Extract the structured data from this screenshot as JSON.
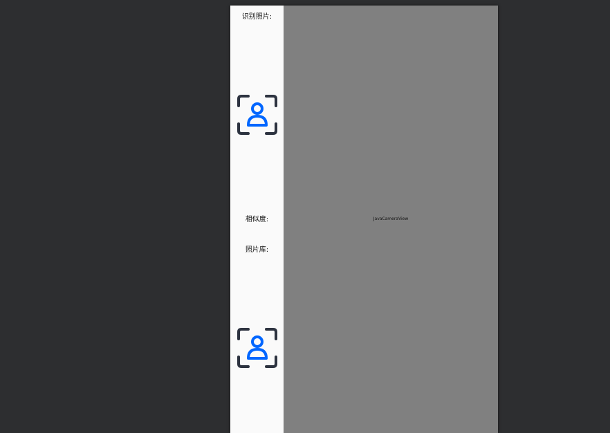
{
  "labels": {
    "recognize_photo": "识别照片:",
    "similarity": "相似度:",
    "photo_gallery": "照片库:"
  },
  "icons": {
    "recognize_photo_icon": "face-scan-icon",
    "gallery_photo_icon": "face-scan-icon"
  },
  "camera": {
    "view_label": "JavaCameraView"
  },
  "colors": {
    "accent": "#0066ff",
    "frame": "#2d3340",
    "camera_bg": "#808080",
    "panel_bg": "#fafafa",
    "editor_bg": "#2d2e30"
  }
}
